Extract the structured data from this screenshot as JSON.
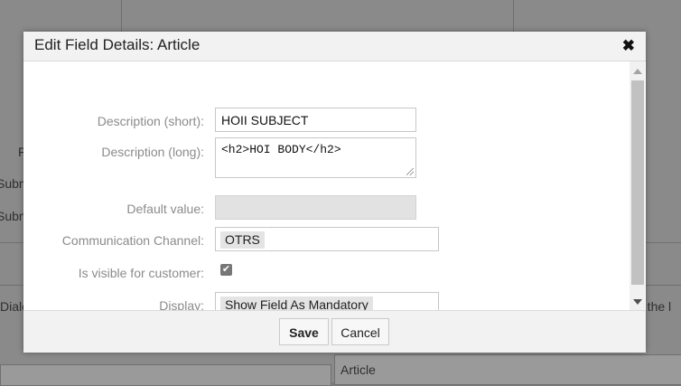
{
  "background": {
    "fragment_1": "F",
    "fragment_2": "Subm",
    "fragment_3": "Subm",
    "fragment_4": "Dialo",
    "fragment_5": "n the l",
    "article_label": "Article"
  },
  "dialog": {
    "title": "Edit Field Details: Article",
    "close_symbol": "✖",
    "fields": {
      "description_short": {
        "label": "Description (short):",
        "value": "HOII SUBJECT"
      },
      "description_long": {
        "label": "Description (long):",
        "value": "<h2>HOI BODY</h2>"
      },
      "default_value": {
        "label": "Default value:",
        "value": ""
      },
      "communication_channel": {
        "label": "Communication Channel:",
        "value": "OTRS"
      },
      "visible_for_customer": {
        "label": "Is visible for customer:",
        "checked": true,
        "check_symbol": "✔"
      },
      "display": {
        "label": "Display:",
        "value": "Show Field As Mandatory"
      }
    },
    "buttons": {
      "save": "Save",
      "cancel": "Cancel"
    }
  }
}
